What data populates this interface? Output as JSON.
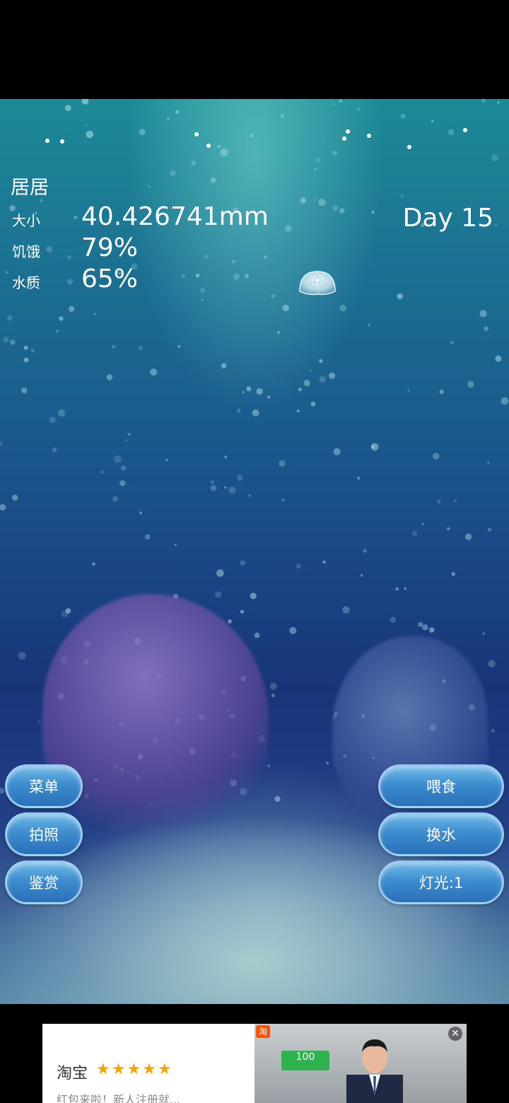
{
  "pet": {
    "name": "居居",
    "day": "Day 15",
    "stats": [
      {
        "label": "大小",
        "value": "40.426741mm"
      },
      {
        "label": "饥饿",
        "value": "79%"
      },
      {
        "label": "水质",
        "value": "65%"
      }
    ]
  },
  "buttons": {
    "menu": "菜单",
    "photo": "拍照",
    "appreciate": "鉴赏",
    "feed": "喂食",
    "change_water": "换水",
    "light": "灯光:1"
  },
  "ad": {
    "brand": "淘宝",
    "stars": "★★★★★",
    "line": "红包来啦！新人注册就...",
    "logo": "淘",
    "coupon": "100",
    "close": "✕"
  },
  "colors": {
    "button_fill": "#3d8dd0",
    "water_top": "#1d8a96",
    "water_deep": "#18357a"
  }
}
